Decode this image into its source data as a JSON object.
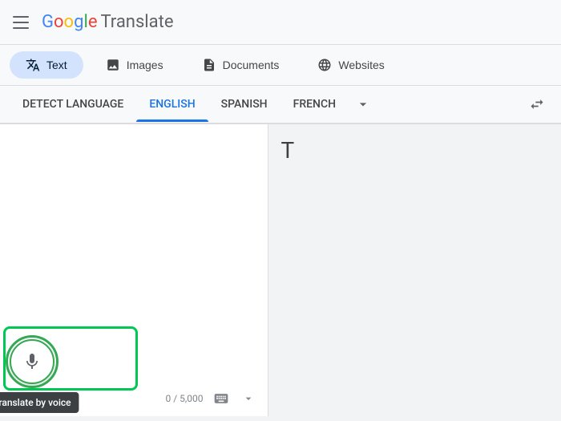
{
  "header": {
    "menu_icon_label": "Menu",
    "logo_google": "Google",
    "logo_translate": "Translate"
  },
  "tabs": [
    {
      "id": "text",
      "label": "Text",
      "active": true,
      "icon": "translate-icon"
    },
    {
      "id": "images",
      "label": "Images",
      "active": false,
      "icon": "image-icon"
    },
    {
      "id": "documents",
      "label": "Documents",
      "active": false,
      "icon": "document-icon"
    },
    {
      "id": "websites",
      "label": "Websites",
      "active": false,
      "icon": "globe-icon"
    }
  ],
  "languages": {
    "source": [
      {
        "id": "detect",
        "label": "DETECT LANGUAGE",
        "active": false
      },
      {
        "id": "english",
        "label": "ENGLISH",
        "active": true
      },
      {
        "id": "spanish",
        "label": "SPANISH",
        "active": false
      },
      {
        "id": "french",
        "label": "FRENCH",
        "active": false
      }
    ],
    "swap_label": "Swap languages"
  },
  "input": {
    "placeholder": "",
    "current_value": "",
    "char_count": "0 / 5,000"
  },
  "voice": {
    "button_label": "Translate by voice",
    "tooltip": "Translate by voice"
  },
  "output": {
    "text": "T"
  }
}
